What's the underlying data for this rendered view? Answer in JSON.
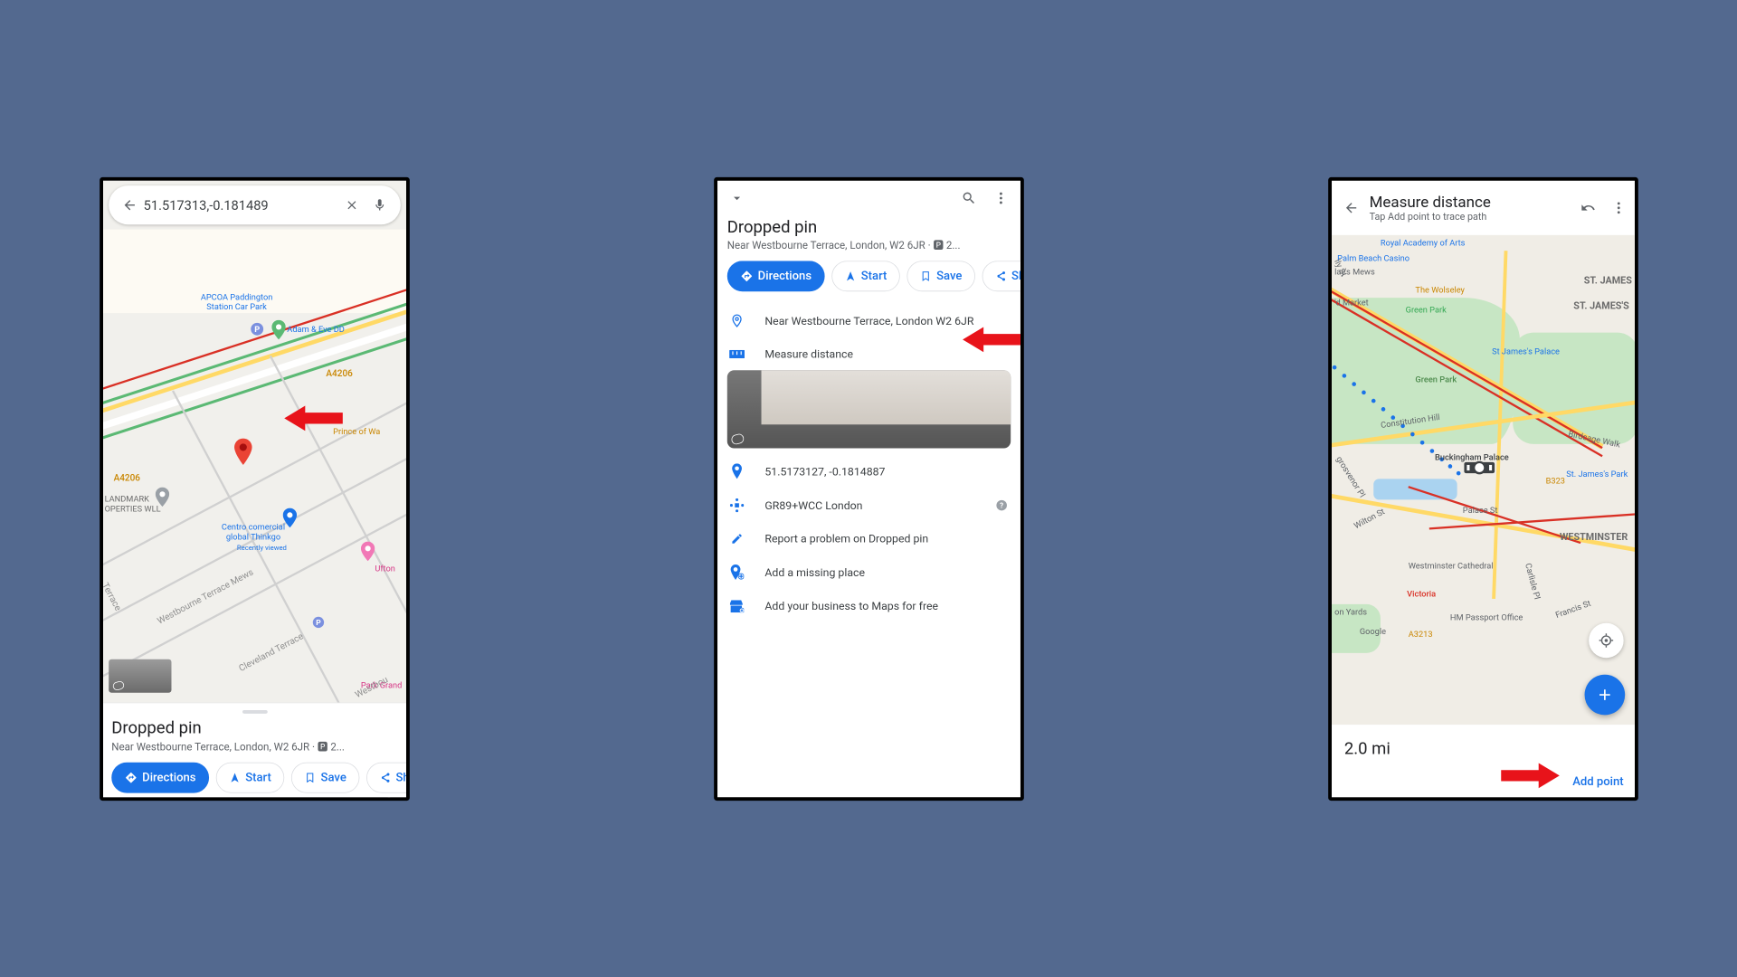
{
  "phone1": {
    "search_value": "51.517313,-0.181489",
    "map_labels": {
      "a4206_1": "A4206",
      "a4206_2": "A4206",
      "apcoa": "APCOA Paddington\nStation Car Park",
      "adam_eve": "Adam & Eve DD",
      "prince": "Prince of Wa",
      "landmark": "LANDMARK\nOPERTIES WLL",
      "centro": "Centro comercial\nglobal Thinkgo",
      "recently": "Recently viewed",
      "ufton": "Ufton",
      "park_grand": "Park Grand",
      "westbourne_mews": "Westbourne Terrace Mews",
      "cleveland": "Cleveland Terrace",
      "westbourne": "Westbou",
      "terrace": "Terrace"
    },
    "card": {
      "title": "Dropped pin",
      "subtitle": "Near Westbourne Terrace, London, W2 6JR · 🅿 2...",
      "directions": "Directions",
      "start": "Start",
      "save": "Save",
      "share": "Sha"
    }
  },
  "phone2": {
    "title": "Dropped pin",
    "subtitle": "Near Westbourne Terrace, London, W2 6JR · 🅿 2...",
    "actions": {
      "directions": "Directions",
      "start": "Start",
      "save": "Save",
      "share": "Sha"
    },
    "rows": {
      "address": "Near Westbourne Terrace, London W2 6JR",
      "measure": "Measure distance",
      "coords": "51.5173127, -0.1814887",
      "pluscode": "GR89+WCC London",
      "report": "Report a problem on Dropped pin",
      "add_place": "Add a missing place",
      "add_business": "Add your business to Maps for free"
    }
  },
  "phone3": {
    "title": "Measure distance",
    "subtitle": "Tap Add point to trace path",
    "distance": "2.0 mi",
    "add_point": "Add point",
    "map_labels": {
      "royal_academy": "Royal Academy of Arts",
      "palm_beach": "Palm Beach Casino",
      "wolseley": "The Wolseley",
      "st_james": "ST. JAMES'S",
      "st_james_2": "ST. JAMES",
      "green_park_st": "Green Park",
      "green_park": "Green Park",
      "st_james_palace": "St James's Palace",
      "constitution": "Constitution Hill",
      "buckingham": "Buckingham Palace",
      "birdcage": "Birdcage Walk",
      "st_james_park": "St. James's Park",
      "b323": "B323",
      "palace_st": "Palace St",
      "westminster": "WESTMINSTER",
      "westminster_cath": "Westminster Cathedral",
      "victoria": "Victoria",
      "on_yards": "on Yards",
      "hm_passport": "HM Passport Office",
      "google": "Google",
      "a3213": "A3213",
      "francis_st": "Francis St",
      "carlisle": "Carlisle Pl",
      "hyde_market": "'d Market",
      "hays_mews": "lay's Mews",
      "grosvenor": "grosvenor Pl",
      "wilton": "Wilton St",
      "lly_st": "lly St"
    }
  }
}
